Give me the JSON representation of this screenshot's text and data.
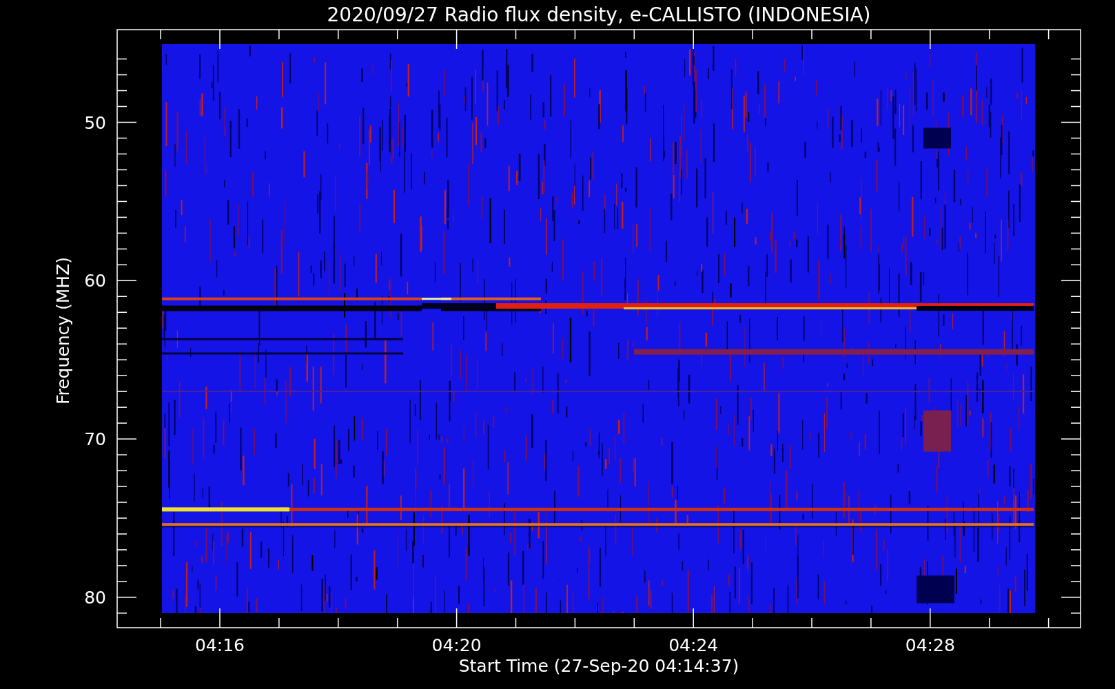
{
  "title": "2020/09/27  Radio flux density, e-CALLISTO (INDONESIA)",
  "y_axis": {
    "label": "Frequency (MHZ)",
    "ticks": [
      "50",
      "60",
      "70",
      "80"
    ]
  },
  "x_axis": {
    "label": "Start Time (27-Sep-20 04:14:37)",
    "ticks": [
      "04:16",
      "04:20",
      "04:24",
      "04:28"
    ]
  }
}
